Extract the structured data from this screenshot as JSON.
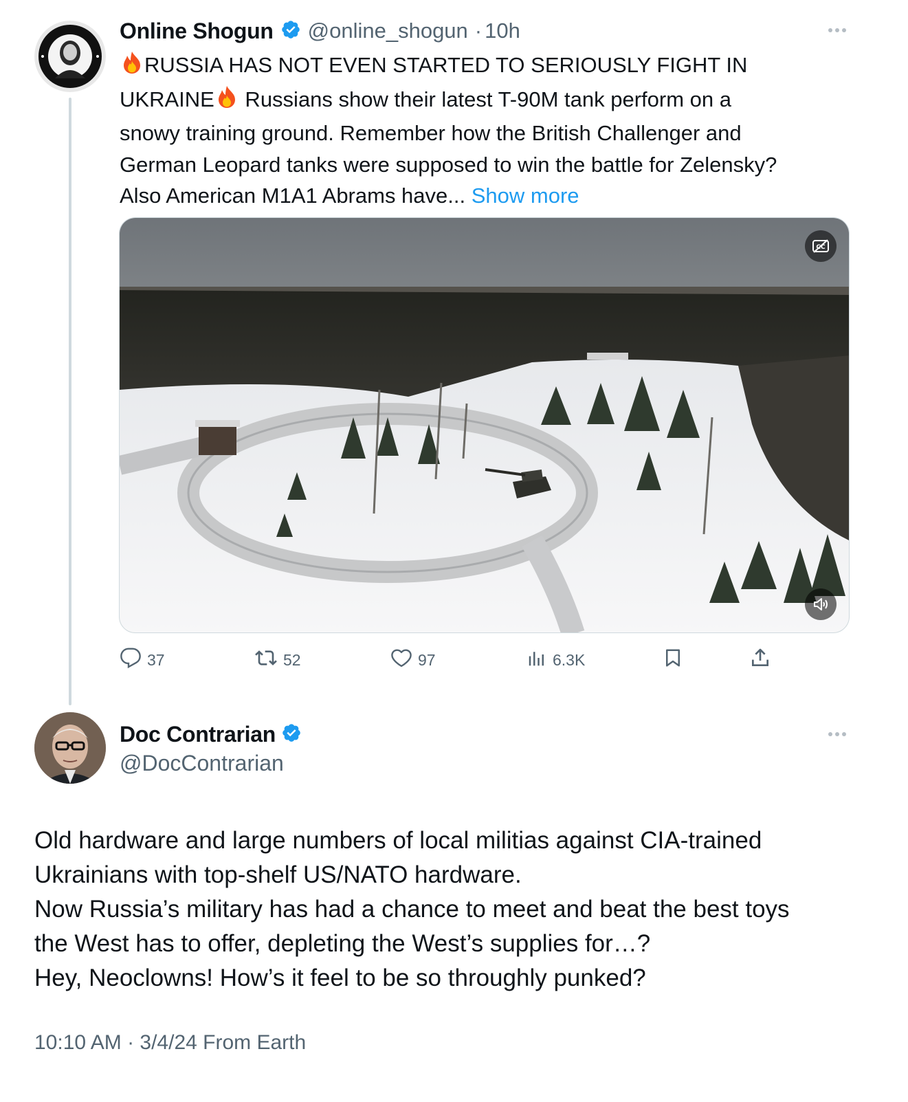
{
  "quoted_tweet": {
    "author_name": "Online Shogun",
    "handle": "@online_shogun",
    "separator": "·",
    "time": "10h",
    "text_line1": "RUSSIA HAS NOT EVEN STARTED TO SERIOUSLY FIGHT IN",
    "text_line2a": "UKRAINE",
    "text_line2b": " Russians show their latest T-90M tank perform on a",
    "text_line3": "snowy training ground. Remember how the British Challenger and",
    "text_line4": "German Leopard tanks were supposed to win the battle for Zelensky?",
    "text_line5": "Also American M1A1 Abrams have... ",
    "show_more": "Show more",
    "avatar_icon": "preachers-avatar",
    "avatar_lettering": "TEXAS MOST WANTED · THE PREACHERS",
    "actions": {
      "replies": "37",
      "reposts": "52",
      "likes": "97",
      "views": "6.3K"
    }
  },
  "reply_tweet": {
    "author_name": "Doc Contrarian",
    "handle": "@DocContrarian",
    "avatar_icon": "doc-contrarian-avatar",
    "lines": [
      "Old hardware and large numbers of local militias against CIA-trained",
      "Ukrainians with top-shelf US/NATO hardware.",
      "Now Russia’s military has had a chance to meet and beat the best toys",
      "the West has to offer, depleting the West’s supplies for…?",
      "Hey, Neoclowns! How’s it feel to be so throughly punked?"
    ],
    "meta": "10:10 AM · 3/4/24 From Earth"
  },
  "colors": {
    "verified": "#1d9bf0",
    "link": "#1d9bf0",
    "secondary_text": "#536471",
    "thread_line": "#cfd9de"
  }
}
